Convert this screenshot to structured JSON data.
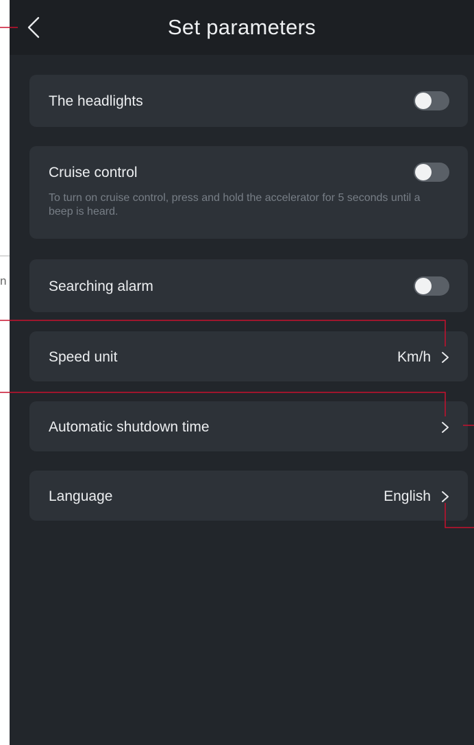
{
  "header": {
    "title": "Set parameters"
  },
  "settings": [
    {
      "label": "The headlights",
      "kind": "toggle",
      "on": false
    },
    {
      "label": "Cruise control",
      "kind": "toggle",
      "on": false,
      "description": "To turn on cruise control, press and hold the accelerator for 5 seconds until a beep is heard."
    },
    {
      "label": "Searching alarm",
      "kind": "toggle",
      "on": false
    },
    {
      "label": "Speed unit",
      "kind": "select",
      "value": "Km/h"
    },
    {
      "label": "Automatic shutdown time",
      "kind": "select",
      "value": ""
    },
    {
      "label": "Language",
      "kind": "select",
      "value": "English"
    }
  ],
  "colors": {
    "background": "#22262b",
    "header": "#1c1f23",
    "card": "#2d3238",
    "annotation": "#c8102e"
  },
  "margin_glyph": "n"
}
